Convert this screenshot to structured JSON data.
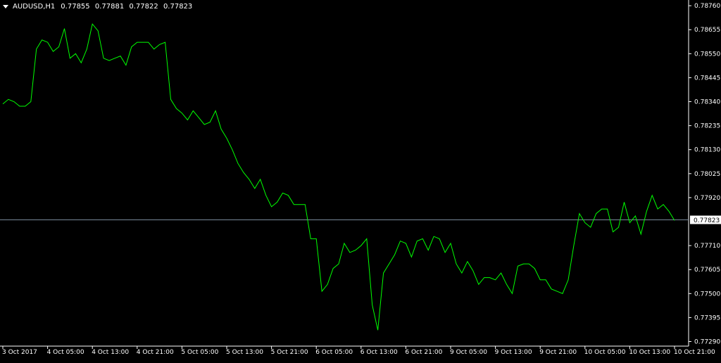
{
  "header": {
    "symbol": "AUDUSD,H1",
    "open": "0.77855",
    "high": "0.77881",
    "low": "0.77822",
    "close": "0.77823"
  },
  "colors": {
    "background": "#000000",
    "line": "#00ff00",
    "axis": "#ffffff",
    "current_price_line": "#778899",
    "current_price_box": "#ffffff",
    "current_price_text": "#000000"
  },
  "chart_data": {
    "type": "line",
    "title": "",
    "current_price": 0.77823,
    "y_ticks": [
      "0.78760",
      "0.78655",
      "0.78550",
      "0.78445",
      "0.78340",
      "0.78235",
      "0.78130",
      "0.78025",
      "0.77920",
      "0.77710",
      "0.77605",
      "0.77500",
      "0.77395",
      "0.77290"
    ],
    "y_range": [
      0.7727,
      0.78785
    ],
    "x_ticks": [
      {
        "label": "3 Oct 2017",
        "index": 0
      },
      {
        "label": "4 Oct 05:00",
        "index": 8
      },
      {
        "label": "4 Oct 13:00",
        "index": 16
      },
      {
        "label": "4 Oct 21:00",
        "index": 24
      },
      {
        "label": "5 Oct 05:00",
        "index": 32
      },
      {
        "label": "5 Oct 13:00",
        "index": 40
      },
      {
        "label": "5 Oct 21:00",
        "index": 48
      },
      {
        "label": "6 Oct 05:00",
        "index": 56
      },
      {
        "label": "6 Oct 13:00",
        "index": 64
      },
      {
        "label": "6 Oct 21:00",
        "index": 72
      },
      {
        "label": "9 Oct 05:00",
        "index": 80
      },
      {
        "label": "9 Oct 13:00",
        "index": 88
      },
      {
        "label": "9 Oct 21:00",
        "index": 96
      },
      {
        "label": "10 Oct 05:00",
        "index": 104
      },
      {
        "label": "10 Oct 13:00",
        "index": 112
      },
      {
        "label": "10 Oct 21:00",
        "index": 120
      }
    ],
    "values": [
      0.7833,
      0.7835,
      0.7834,
      0.7832,
      0.7832,
      0.7834,
      0.7857,
      0.7861,
      0.786,
      0.7856,
      0.7858,
      0.7866,
      0.7853,
      0.7855,
      0.7851,
      0.7857,
      0.7868,
      0.7865,
      0.7853,
      0.7852,
      0.7853,
      0.7854,
      0.785,
      0.7858,
      0.786,
      0.786,
      0.786,
      0.7857,
      0.7859,
      0.786,
      0.7835,
      0.7831,
      0.7829,
      0.7826,
      0.783,
      0.7827,
      0.7824,
      0.7825,
      0.783,
      0.7822,
      0.7818,
      0.7813,
      0.7807,
      0.7803,
      0.78,
      0.7796,
      0.78,
      0.7793,
      0.7788,
      0.779,
      0.7794,
      0.7793,
      0.7789,
      0.7789,
      0.7789,
      0.7774,
      0.7774,
      0.7751,
      0.7754,
      0.7761,
      0.7763,
      0.7772,
      0.7768,
      0.7769,
      0.7771,
      0.7774,
      0.7745,
      0.7734,
      0.7759,
      0.7763,
      0.7767,
      0.7773,
      0.7772,
      0.7766,
      0.7773,
      0.7774,
      0.7769,
      0.7775,
      0.7774,
      0.7768,
      0.7772,
      0.7763,
      0.7759,
      0.7764,
      0.776,
      0.7754,
      0.7757,
      0.7757,
      0.7756,
      0.7759,
      0.7754,
      0.775,
      0.7762,
      0.7763,
      0.7763,
      0.7761,
      0.7756,
      0.7756,
      0.7752,
      0.7751,
      0.775,
      0.7756,
      0.7771,
      0.7785,
      0.7781,
      0.7779,
      0.7785,
      0.7787,
      0.7787,
      0.7777,
      0.7779,
      0.779,
      0.7781,
      0.7784,
      0.7776,
      0.7786,
      0.7793,
      0.7787,
      0.7789,
      0.7786,
      0.7782
    ]
  }
}
